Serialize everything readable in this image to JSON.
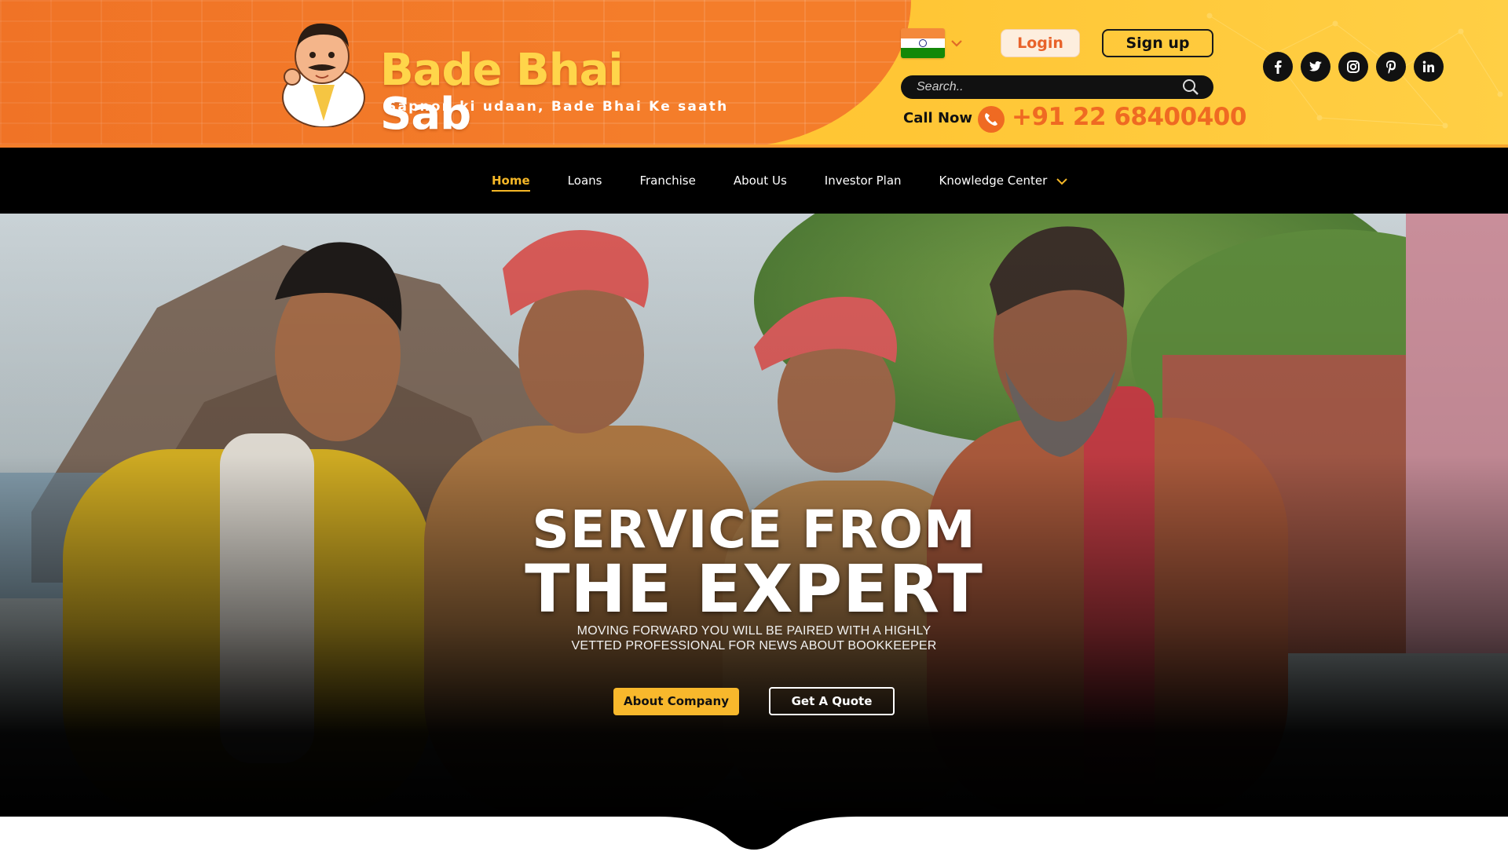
{
  "brand": {
    "name_part1": "Bade Bhai",
    "name_part2": "Sab",
    "tagline": "Sapnon ki udaan, Bade Bhai Ke saath",
    "mascot_icon": "mascot-logo-icon"
  },
  "header": {
    "language_flag": "india-flag-icon",
    "login_label": "Login",
    "signup_label": "Sign up",
    "search": {
      "placeholder": "Search..",
      "value": ""
    },
    "call_label": "Call Now",
    "phone_number": "+91 22 68400400",
    "social": [
      "facebook-icon",
      "twitter-icon",
      "instagram-icon",
      "pinterest-icon",
      "linkedin-icon"
    ]
  },
  "nav": {
    "items": [
      {
        "label": "Home",
        "active": true
      },
      {
        "label": "Loans",
        "active": false
      },
      {
        "label": "Franchise",
        "active": false
      },
      {
        "label": "About Us",
        "active": false
      },
      {
        "label": "Investor Plan",
        "active": false
      },
      {
        "label": "Knowledge Center",
        "active": false,
        "dropdown": true
      }
    ]
  },
  "hero": {
    "title_line1": "SERVICE FROM",
    "title_line2": "THE EXPERT",
    "subtitle_line1": "MOVING FORWARD YOU WILL BE PAIRED WITH A HIGHLY",
    "subtitle_line2": "VETTED PROFESSIONAL FOR NEWS ABOUT BOOKKEEPER",
    "primary_button": "About Company",
    "secondary_button": "Get A Quote"
  },
  "colors": {
    "header_orange": "#f47d2a",
    "header_yellow": "#ffc22e",
    "accent_yellow": "#f8b82c",
    "phone_orange": "#ef6a22",
    "nav_bg": "#000000"
  }
}
